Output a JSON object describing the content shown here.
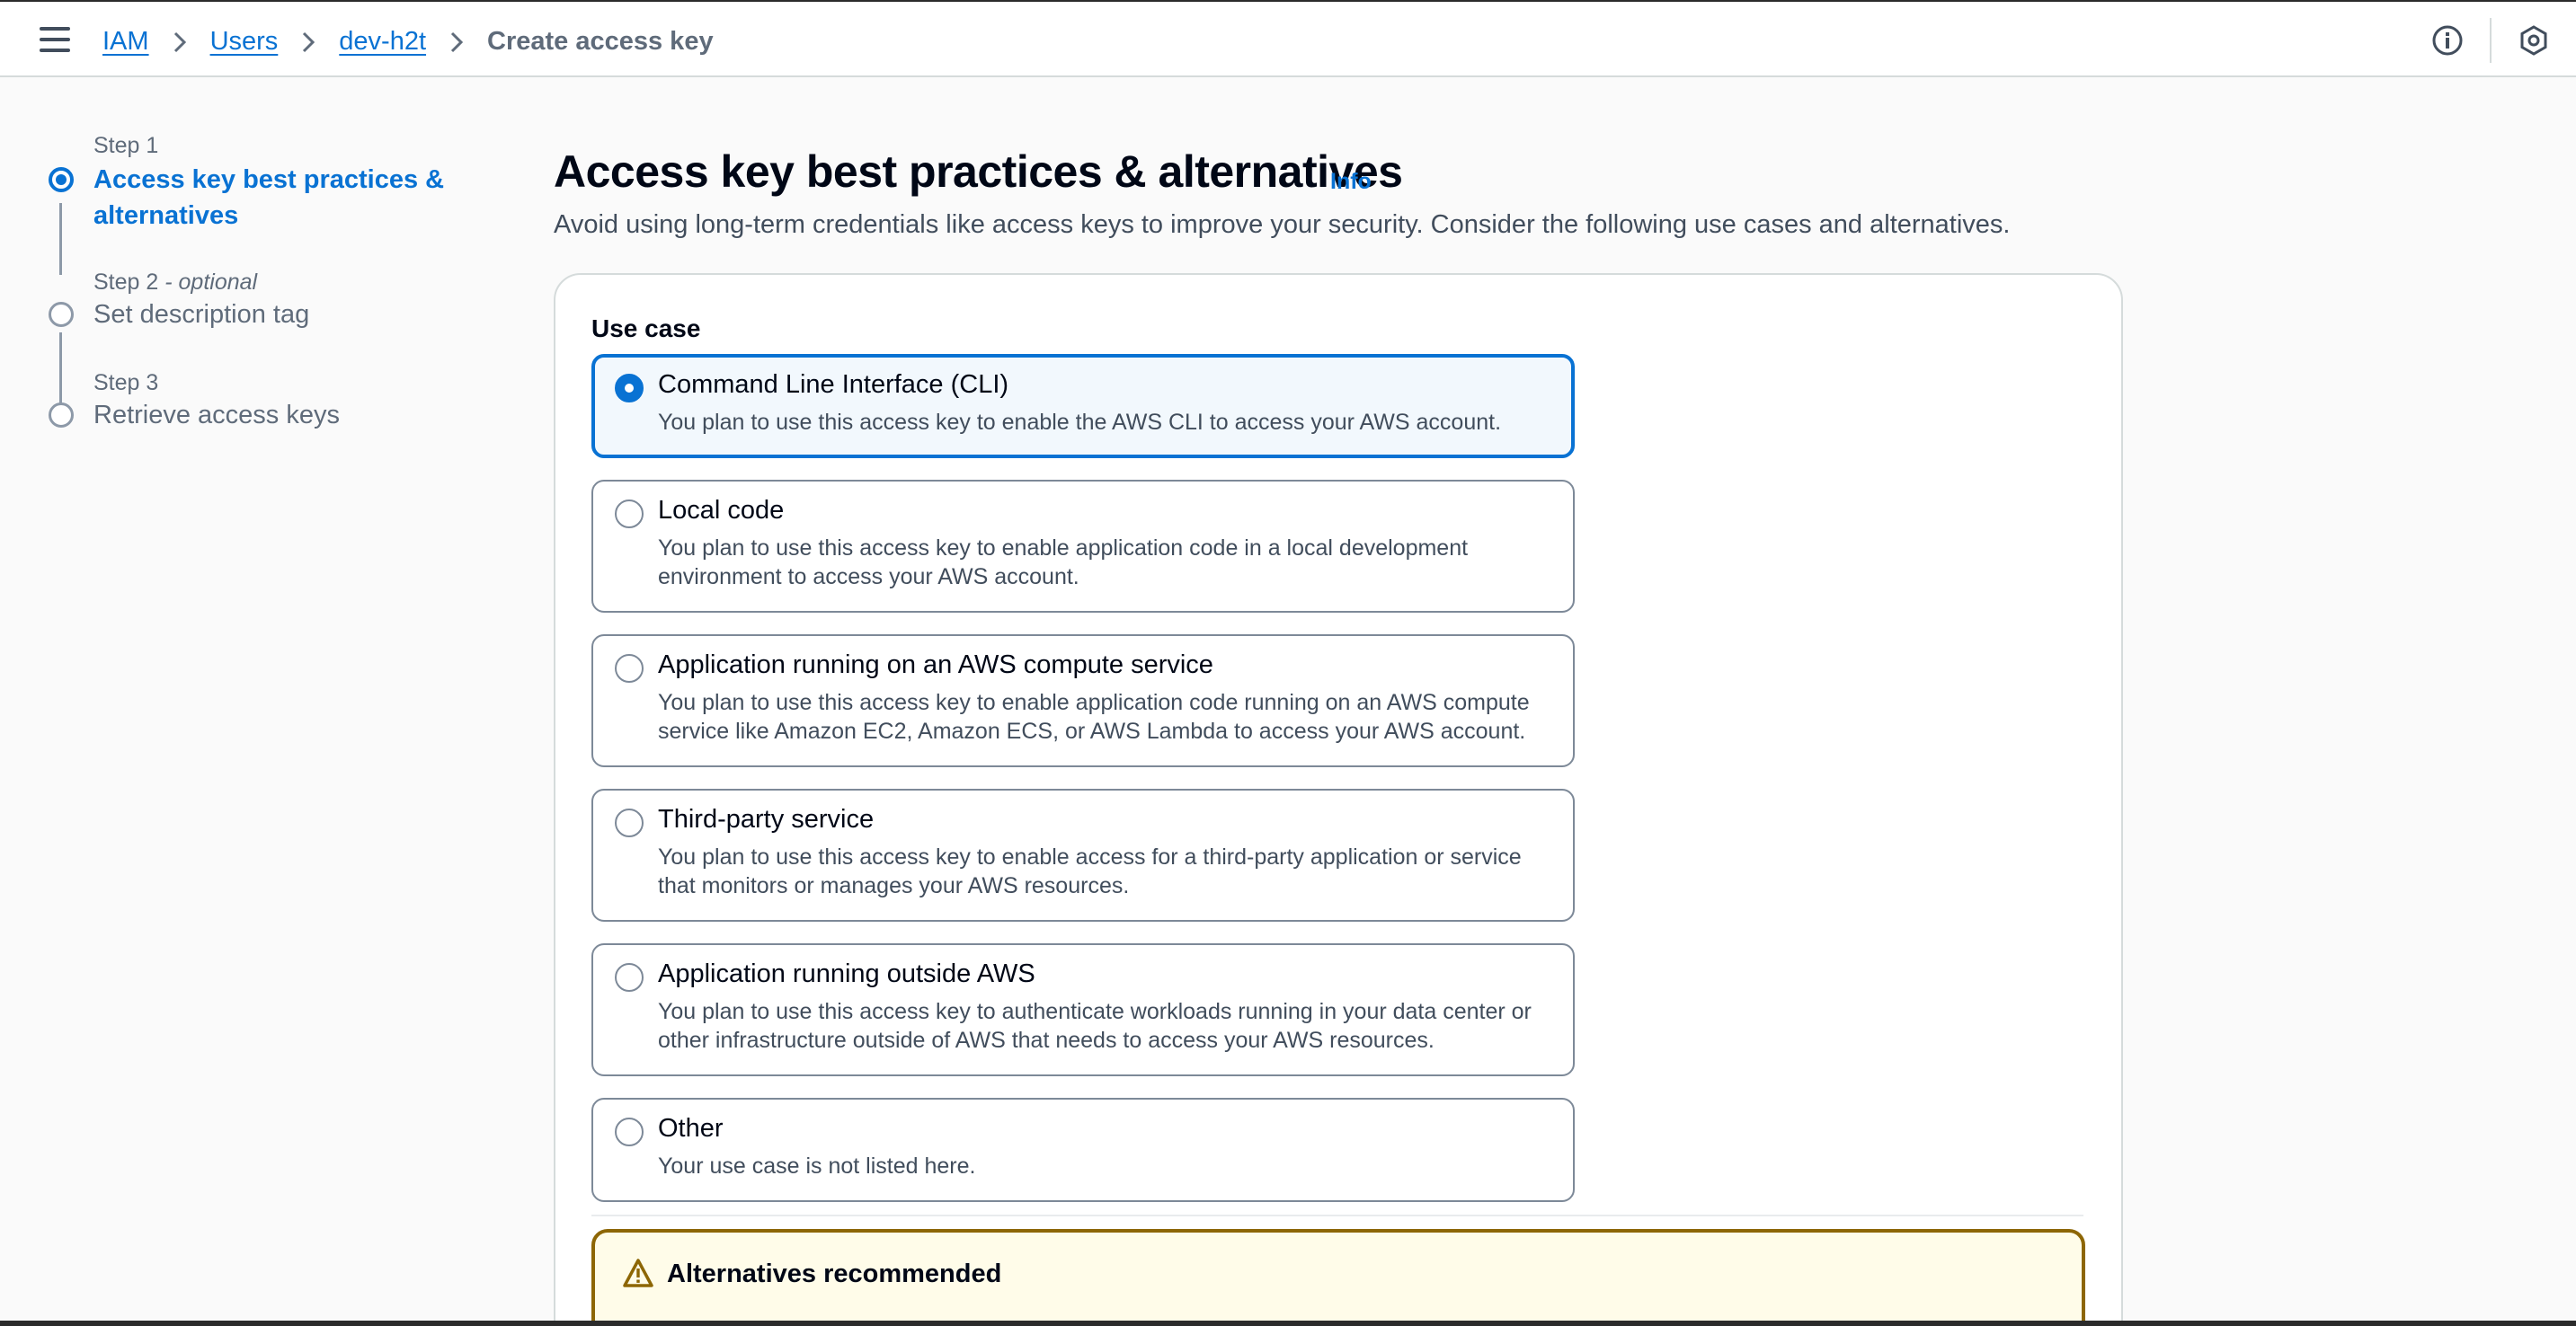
{
  "breadcrumb": {
    "items": [
      "IAM",
      "Users",
      "dev-h2t"
    ],
    "current": "Create access key"
  },
  "icons": {
    "menu": "hamburger-menu-icon",
    "info": "info-circle-icon",
    "settings": "hexagon-settings-icon",
    "warning": "warning-triangle-icon"
  },
  "steps": [
    {
      "label": "Step 1",
      "title": "Access key best practices & alternatives",
      "state": "active"
    },
    {
      "label": "Step 2",
      "label_suffix": "- optional",
      "title": "Set description tag",
      "state": "inactive"
    },
    {
      "label": "Step 3",
      "title": "Retrieve access keys",
      "state": "inactive"
    }
  ],
  "page": {
    "title": "Access key best practices & alternatives",
    "info_link": "Info",
    "description": "Avoid using long-term credentials like access keys to improve your security. Consider the following use cases and alternatives."
  },
  "use_case": {
    "label": "Use case",
    "selected": "Command Line Interface (CLI)",
    "options": [
      {
        "title": "Command Line Interface (CLI)",
        "description": "You plan to use this access key to enable the AWS CLI to access your AWS account.",
        "selected": true
      },
      {
        "title": "Local code",
        "description": "You plan to use this access key to enable application code in a local development environment to access your AWS account.",
        "selected": false
      },
      {
        "title": "Application running on an AWS compute service",
        "description": "You plan to use this access key to enable application code running on an AWS compute service like Amazon EC2, Amazon ECS, or AWS Lambda to access your AWS account.",
        "selected": false
      },
      {
        "title": "Third-party service",
        "description": "You plan to use this access key to enable access for a third-party application or service that monitors or manages your AWS resources.",
        "selected": false
      },
      {
        "title": "Application running outside AWS",
        "description": "You plan to use this access key to authenticate workloads running in your data center or other infrastructure outside of AWS that needs to access your AWS resources.",
        "selected": false
      },
      {
        "title": "Other",
        "description": "Your use case is not listed here.",
        "selected": false
      }
    ]
  },
  "alert": {
    "title": "Alternatives recommended"
  },
  "colors": {
    "accent": "#0972d3",
    "warning_border": "#8d6605",
    "warning_bg": "#fffce9"
  }
}
